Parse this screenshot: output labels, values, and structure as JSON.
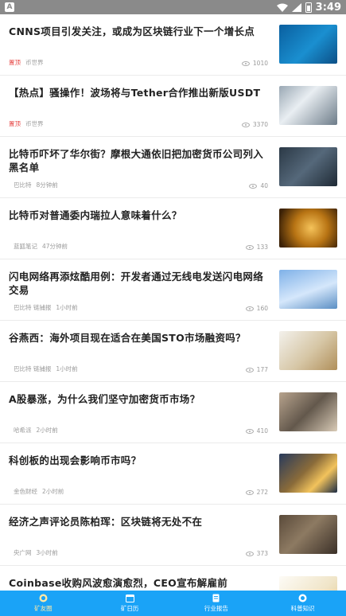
{
  "status_bar": {
    "app_badge": "A",
    "time": "3:49"
  },
  "articles": [
    {
      "title": "CNNS项目引发关注，或成为区块链行业下一个增长点",
      "tag": "置顶",
      "source": "币世界",
      "time": "",
      "views": "1010"
    },
    {
      "title": "【热点】骚操作！波场将与Tether合作推出新版USDT",
      "tag": "置顶",
      "source": "币世界",
      "time": "",
      "views": "3370"
    },
    {
      "title": "比特币吓坏了华尔街？摩根大通依旧把加密货币公司列入黑名单",
      "tag": "",
      "source": "巴比特",
      "time": "8分钟前",
      "views": "40"
    },
    {
      "title": "比特币对普通委内瑞拉人意味着什么？",
      "tag": "",
      "source": "蓝狐笔记",
      "time": "47分钟前",
      "views": "133"
    },
    {
      "title": "闪电网络再添炫酷用例：开发者通过无线电发送闪电网络交易",
      "tag": "",
      "source": "巴比特 链捕报",
      "time": "1小时前",
      "views": "160"
    },
    {
      "title": "谷燕西：海外项目现在适合在美国STO市场融资吗？",
      "tag": "",
      "source": "巴比特 链捕报",
      "time": "1小时前",
      "views": "177"
    },
    {
      "title": "A股暴涨，为什么我们坚守加密货币市场？",
      "tag": "",
      "source": "哈希派",
      "time": "2小时前",
      "views": "410"
    },
    {
      "title": "科创板的出现会影响币市吗？",
      "tag": "",
      "source": "金色财经",
      "time": "2小时前",
      "views": "272"
    },
    {
      "title": "经济之声评论员陈柏珲：区块链将无处不在",
      "tag": "",
      "source": "央广网",
      "time": "3小时前",
      "views": "373"
    },
    {
      "title": "Coinbase收购风波愈演愈烈，CEO宣布解雇前Hacking Team成员",
      "tag": "",
      "source": "",
      "time": "",
      "views": ""
    }
  ],
  "bottom_nav": [
    {
      "label": "矿友圈",
      "icon": "coin-icon",
      "active": true
    },
    {
      "label": "矿日历",
      "icon": "calendar-icon",
      "active": false
    },
    {
      "label": "行业报告",
      "icon": "report-icon",
      "active": false
    },
    {
      "label": "科普知识",
      "icon": "knowledge-icon",
      "active": false
    }
  ],
  "colors": {
    "status_bar": "#8a8a8a",
    "bottom_nav": "#1aa3f7",
    "tag": "#e64340",
    "active_tab": "#ffe9a6"
  }
}
